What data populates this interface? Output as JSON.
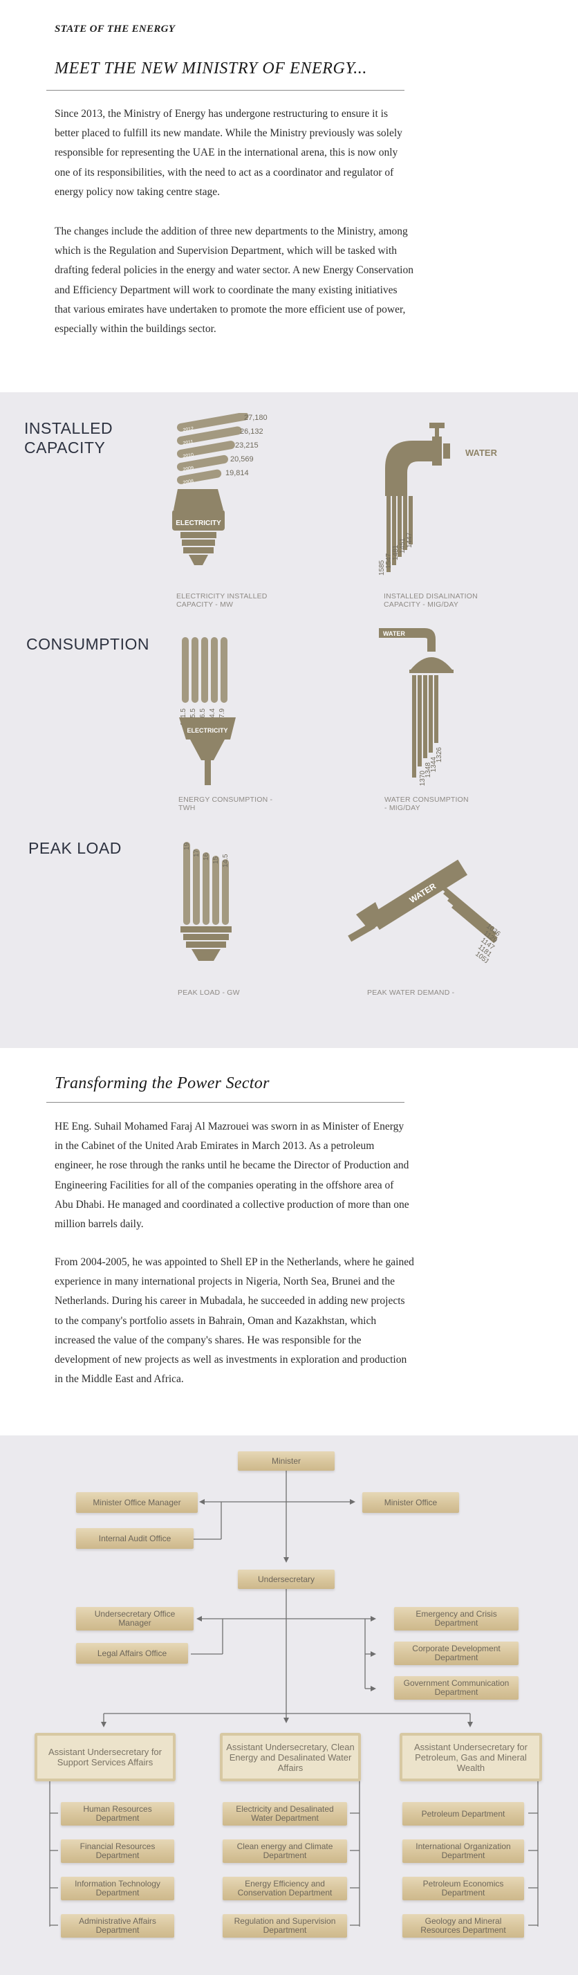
{
  "article": {
    "kicker": "STATE OF THE ENERGY",
    "headline": "MEET THE NEW MINISTRY OF ENERGY...",
    "paragraphs": [
      "Since 2013, the Ministry of Energy has undergone restructuring to ensure it is better placed to fulfill its new mandate. While the Ministry previously was solely responsible for representing the UAE in the international arena, this is now only one of its responsibilities, with the need to act as a coordinator and regulator of energy policy now taking centre stage.",
      "The changes include the addition of three new departments to the Ministry, among which is the Regulation and Supervision Department, which will be tasked with drafting federal policies in the energy and water sector. A new Energy Conservation and Efficiency Department will work to coordinate the many existing initiatives that various emirates have undertaken to promote the more efficient use of power, especially within the buildings sector."
    ]
  },
  "infographic": {
    "sections": {
      "installed": "INSTALLED\nCAPACITY",
      "consumption": "CONSUMPTION",
      "peak": "PEAK LOAD"
    },
    "bulb_label": "ELECTRICITY",
    "water_label": "WATER",
    "captions": {
      "elec_installed": "ELECTRICITY INSTALLED\nCAPACITY - MW",
      "desal_installed": "INSTALLED DISALINATION\nCAPACITY - MIG/DAY",
      "energy_consumption": "ENERGY CONSUMPTION -\nTWH",
      "water_consumption": "WATER CONSUMPTION\n- MIG/DAY",
      "peak_load": "PEAK LOAD - GW",
      "peak_water": "PEAK WATER DEMAND -"
    },
    "electricity_installed": {
      "years": [
        "2012",
        "2011",
        "2010",
        "2009",
        "2008"
      ],
      "values": [
        "27,180",
        "26,132",
        "23,215",
        "20,569",
        "19,814"
      ]
    },
    "desal_installed": {
      "values": [
        "1585",
        "1547",
        "1481",
        "1451",
        "1447"
      ]
    },
    "energy_consumption": {
      "values": [
        "101.5",
        "95.5",
        "86.5",
        "84.4",
        "77.9"
      ]
    },
    "water_consumption": {
      "values": [
        "1370",
        "1348",
        "1344",
        "1326",
        "1331"
      ]
    },
    "peak_load": {
      "values": [
        "19",
        "17",
        "16",
        "15",
        "14.5"
      ]
    },
    "peak_water": {
      "values": [
        "1036",
        "1129",
        "1147",
        "1181",
        "1051"
      ]
    }
  },
  "transform": {
    "headline": "Transforming the Power Sector",
    "paragraphs": [
      "HE Eng. Suhail Mohamed Faraj Al Mazrouei was sworn in as Minister of Energy in the Cabinet of the United Arab Emirates in March 2013. As a petroleum engineer, he rose through the ranks until he became the Director of Production and Engineering Facilities for all of the companies operating in the offshore area of Abu Dhabi. He managed and coordinated a collective production of more than one million barrels daily.",
      "From 2004-2005, he was appointed to Shell EP in the Netherlands, where he gained experience in many international projects in Nigeria, North Sea, Brunei and the Netherlands. During his career in Mubadala, he succeeded in adding new projects to the company's portfolio assets in Bahrain, Oman and Kazakhstan, which increased the value of the company's shares. He was responsible for the development of new projects as well as investments in exploration and production in the Middle East and Africa."
    ]
  },
  "org": {
    "minister": "Minister",
    "minister_office_manager": "Minister Office Manager",
    "internal_audit": "Internal Audit Office",
    "minister_office": "Minister Office",
    "undersecretary": "Undersecretary",
    "under_office_manager": "Undersecretary Office Manager",
    "legal_affairs": "Legal Affairs Office",
    "emergency": "Emergency and Crisis Department",
    "corporate_dev": "Corporate Development Department",
    "gov_comm": "Government Communication Department",
    "asst_support": "Assistant Undersecretary for Support Services Affairs",
    "asst_clean": "Assistant Undersecretary, Clean Energy and Desalinated Water Affairs",
    "asst_petroleum": "Assistant Undersecretary for Petroleum, Gas and Mineral Wealth",
    "support_depts": [
      "Human Resources Department",
      "Financial Resources Department",
      "Information Technology Department",
      "Administrative Affairs Department"
    ],
    "clean_depts": [
      "Electricity and Desalinated Water Department",
      "Clean energy and Climate Department",
      "Energy Efficiency and Conservation Department",
      "Regulation and Supervision Department"
    ],
    "petroleum_depts": [
      "Petroleum Department",
      "International Organization Department",
      "Petroleum Economics Department",
      "Geology and Mineral Resources Department"
    ]
  },
  "colors": {
    "olive": "#8f8468",
    "olive_dark": "#6f6750",
    "band": "#ebeaee",
    "ribbon": "#dccaa0"
  }
}
